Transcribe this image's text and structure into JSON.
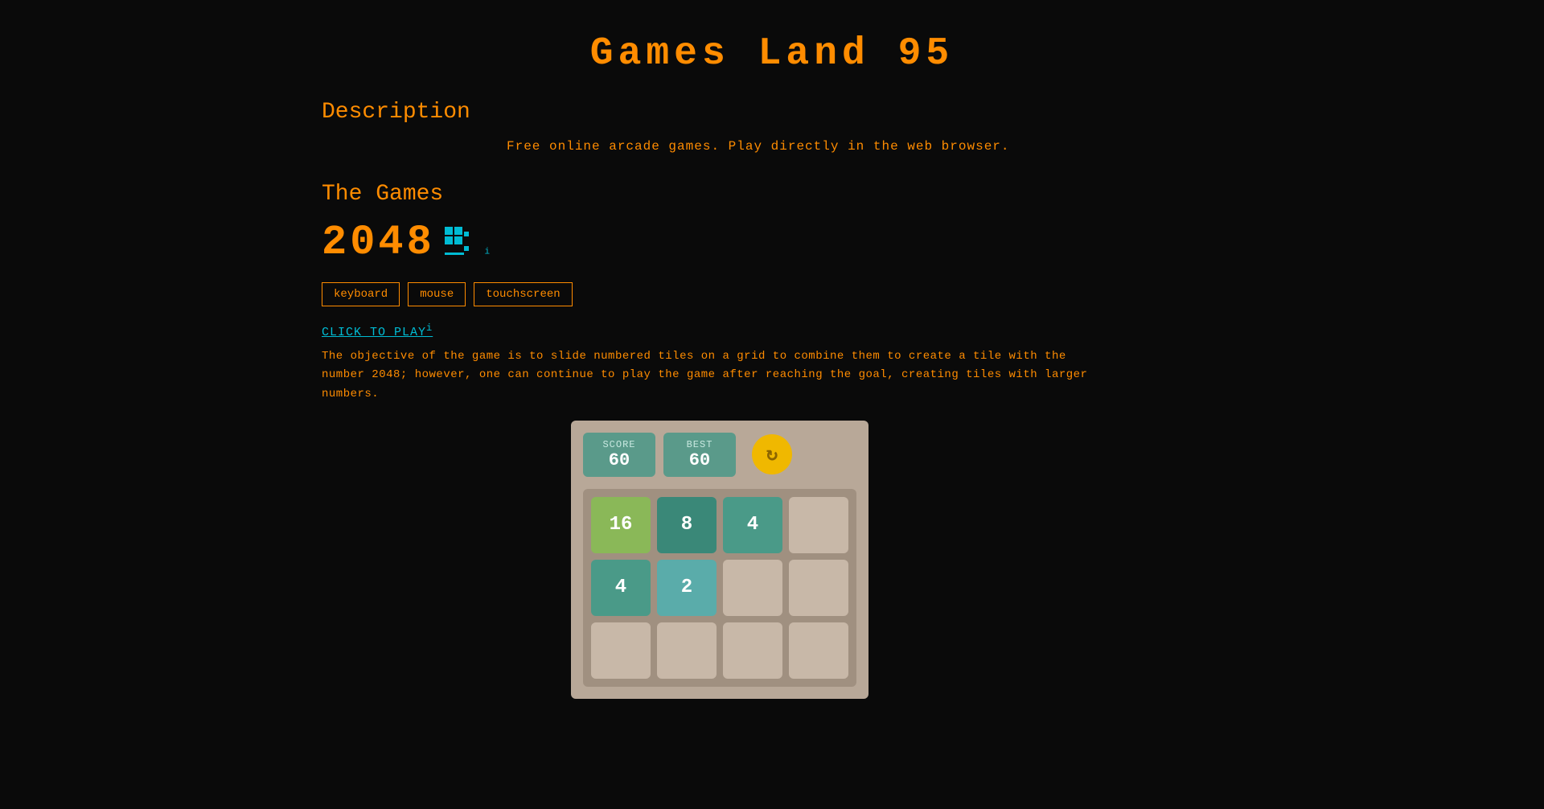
{
  "site": {
    "title": "Games Land 95"
  },
  "description_section": {
    "heading": "Description",
    "body": "Free online arcade games. Play directly in the web browser."
  },
  "games_section": {
    "heading": "The Games",
    "game": {
      "title": "2048",
      "controls": [
        {
          "label": "keyboard"
        },
        {
          "label": "mouse"
        },
        {
          "label": "touchscreen"
        }
      ],
      "click_to_play": "CLICK TO PLAY",
      "description": "The objective of the game is to slide numbered tiles on a grid to combine them to create a tile with the number 2048; however, one can continue to play the game after reaching the goal, creating tiles with larger numbers.",
      "preview": {
        "score_label": "SCORE",
        "score_value": "60",
        "best_label": "BEST",
        "best_value": "60",
        "grid": [
          [
            16,
            8,
            4,
            0
          ],
          [
            4,
            2,
            0,
            0
          ],
          [
            0,
            0,
            0,
            0
          ]
        ]
      }
    }
  },
  "icons": {
    "pixel_game_icon": "⬛",
    "refresh": "G"
  }
}
